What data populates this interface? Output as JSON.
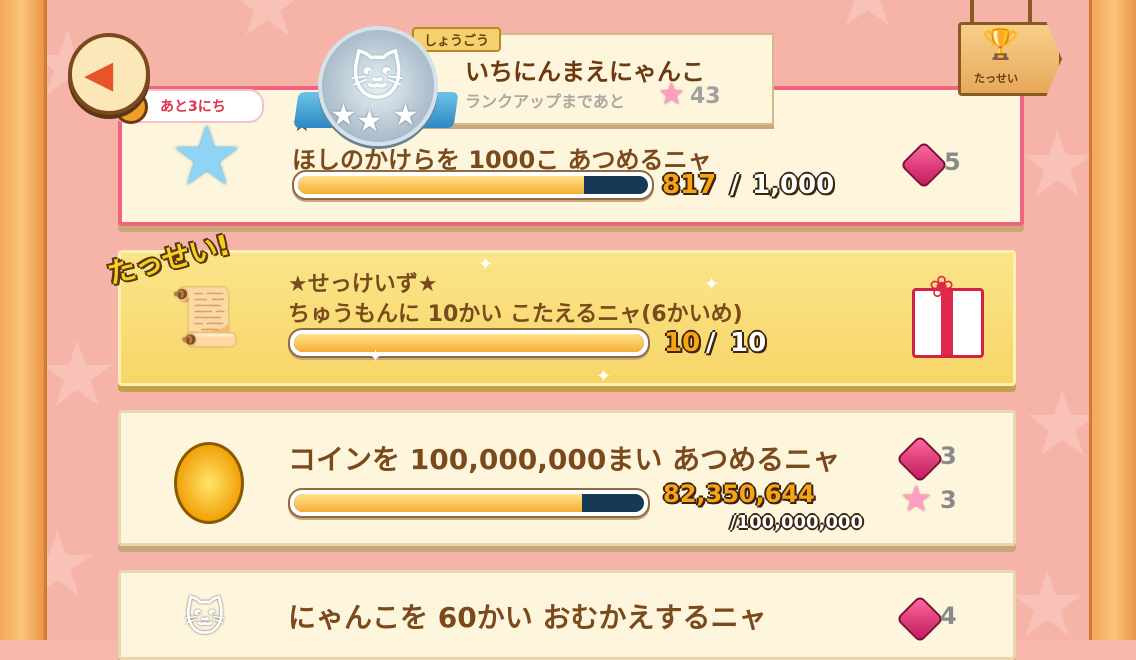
{
  "header": {
    "title_tag": "しょうごう",
    "rank_title": "いちにんまえにゃんこ",
    "rank_sub": "ランクアップまであと",
    "rank_remaining": "43",
    "trophy_label": "たっせい",
    "timer_text": "あと3にち"
  },
  "missions": [
    {
      "stars": "★",
      "title": "ほしのかけらを 1000こ あつめるニャ",
      "progress_current": "817",
      "progress_sep": "/",
      "progress_total": "1,000",
      "progress_fraction": 0.817,
      "reward_gem": "5",
      "icon": "star-icon",
      "state": "active"
    },
    {
      "stars": "★せっけいず★",
      "title": "ちゅうもんに 10かい こたえるニャ(6かいめ)",
      "progress_current": "10",
      "progress_sep": "/",
      "progress_total": "10",
      "progress_fraction": 1.0,
      "done_label": "たっせい!",
      "icon": "blueprint-scroll-icon",
      "state": "done"
    },
    {
      "title": "コインを 100,000,000まい あつめるニャ",
      "progress_current": "82,350,644",
      "progress_total_line": "/100,000,000",
      "progress_fraction": 0.8235,
      "reward_gem": "3",
      "reward_star": "3",
      "icon": "coin-icon",
      "state": "normal"
    },
    {
      "title": "にゃんこを 60かい おむかえするニャ",
      "reward_gem": "4",
      "icon": "cat-icon",
      "state": "normal"
    }
  ],
  "colors": {
    "background": "#f6b3a8",
    "card": "#fdf5dc",
    "done_card": "#f7d567",
    "active_border": "#f06480",
    "bar_fill": "#f5ae33",
    "bar_track": "#163a55"
  }
}
